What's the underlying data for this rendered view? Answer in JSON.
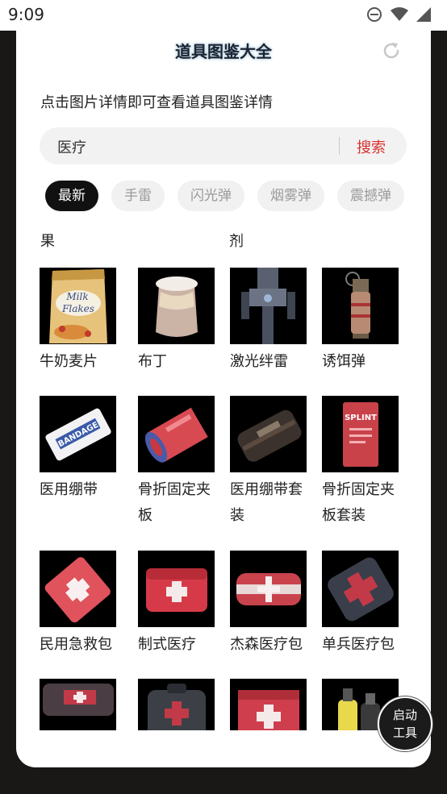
{
  "status_bar": {
    "time": "9:09"
  },
  "header": {
    "title": "道具图鉴大全"
  },
  "hint": "点击图片详情即可查看道具图鉴详情",
  "search": {
    "value": "医疗",
    "button": "搜索"
  },
  "tabs": [
    "最新",
    "手雷",
    "闪光弹",
    "烟雾弹",
    "震撼弹"
  ],
  "active_tab": "最新",
  "partial_row": [
    "果",
    "剂"
  ],
  "items": [
    {
      "name": "牛奶麦片",
      "icon": "milk-flakes-bag"
    },
    {
      "name": "布丁",
      "icon": "pudding-jar"
    },
    {
      "name": "激光绊雷",
      "icon": "laser-tripwire"
    },
    {
      "name": "诱饵弹",
      "icon": "decoy-grenade"
    },
    {
      "name": "医用绷带",
      "icon": "bandage-pack"
    },
    {
      "name": "骨折固定夹板",
      "icon": "splint-roll"
    },
    {
      "name": "医用绷带套装",
      "icon": "bandage-kit-pouch"
    },
    {
      "name": "骨折固定夹板套装",
      "icon": "splint-kit"
    },
    {
      "name": "民用急救包",
      "icon": "civilian-first-aid-kit"
    },
    {
      "name": "制式医疗",
      "icon": "standard-medical-pouch"
    },
    {
      "name": "杰森医疗包",
      "icon": "jason-medical-case"
    },
    {
      "name": "单兵医疗包",
      "icon": "individual-medical-pack"
    },
    {
      "name": "",
      "icon": "medical-belt-pouch"
    },
    {
      "name": "",
      "icon": "medical-backpack"
    },
    {
      "name": "",
      "icon": "red-medical-case"
    },
    {
      "name": "",
      "icon": "spray-canisters"
    }
  ],
  "fab": {
    "line1": "启动",
    "line2": "工具"
  },
  "product_texts": {
    "milk1": "Milk",
    "milk2": "Flakes",
    "bandage": "BANDAGE",
    "splint": "SPLINT"
  },
  "colors": {
    "accent": "#d9302c",
    "active_tab_bg": "#111111"
  }
}
